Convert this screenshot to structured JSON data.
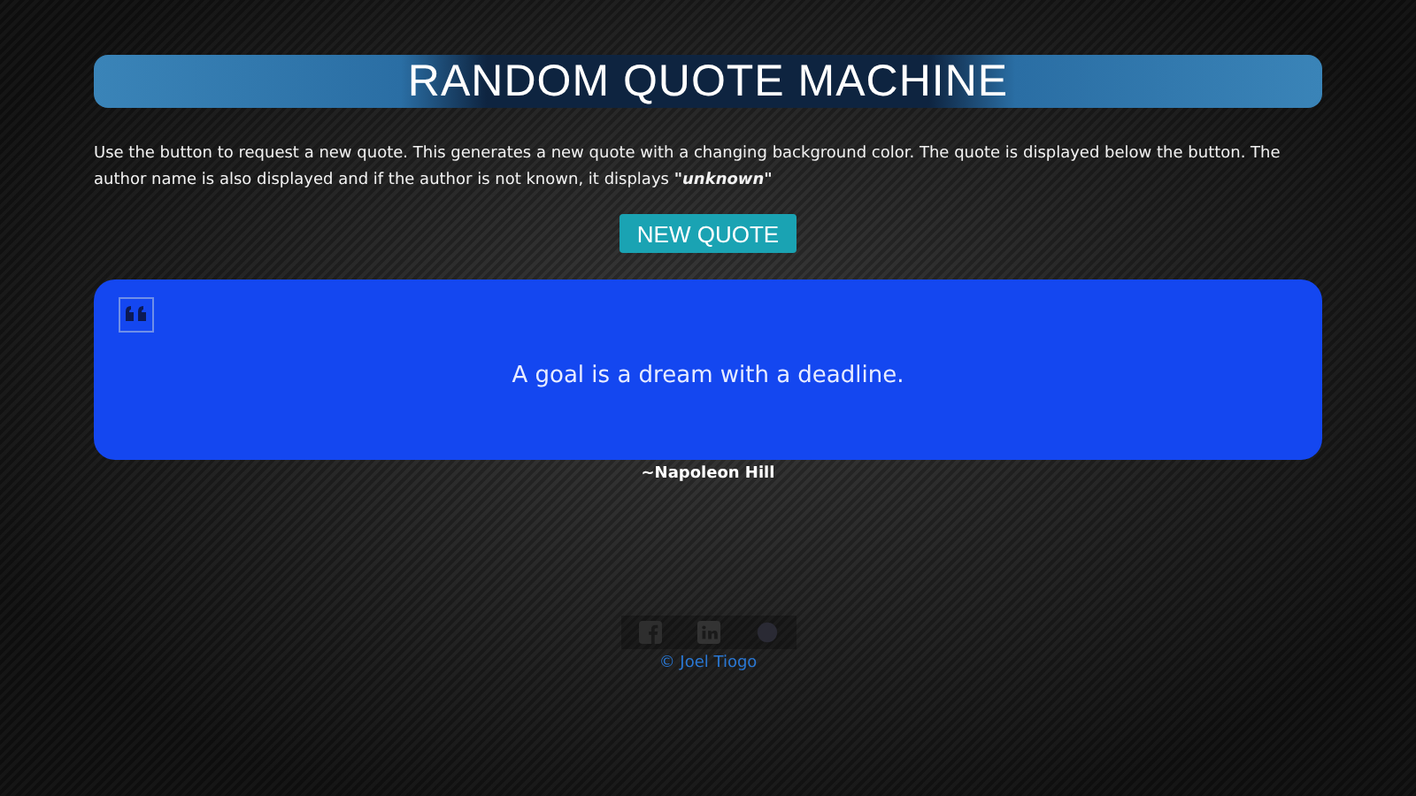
{
  "header": {
    "title": "RANDOM QUOTE MACHINE"
  },
  "description": "Use the button to request a new quote. This generates a new quote with a changing background color. The quote is displayed below the button. The author name is also displayed and if the author is not known, it displays **\"unknown\"**",
  "button": "NEW QUOTE",
  "quote": {
    "text": "A goal is a dream with a deadline.",
    "author": "~Napoleon Hill"
  },
  "footer": {
    "credit": "© Joel Tiogo"
  }
}
